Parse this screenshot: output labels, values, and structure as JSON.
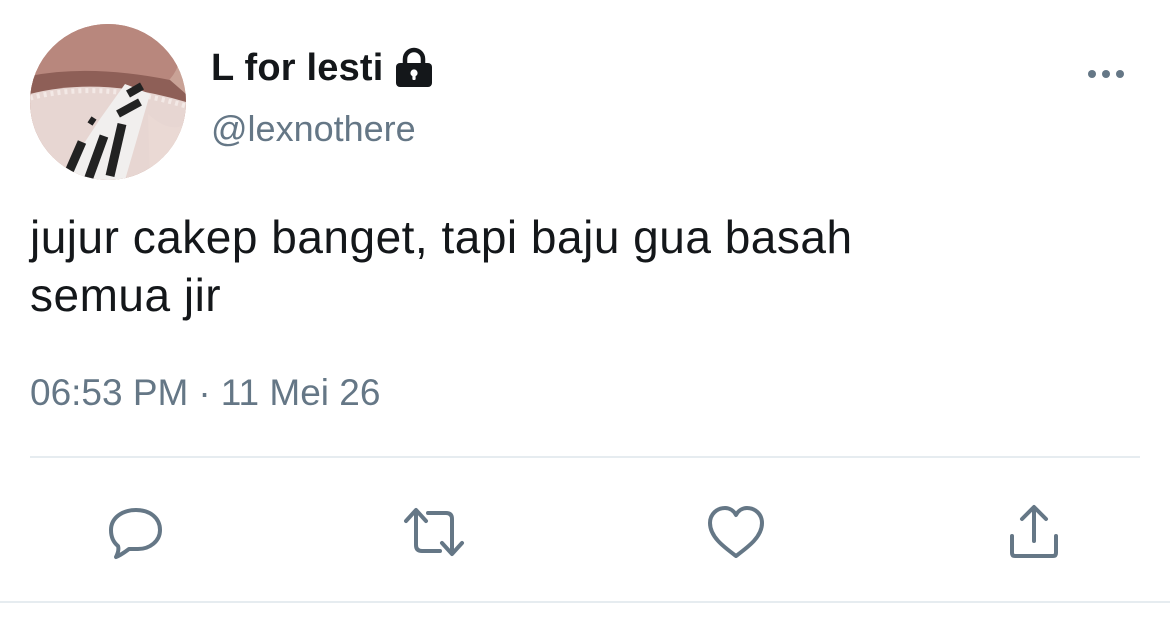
{
  "tweet": {
    "display_name": "L for lesti",
    "handle": "@lexnothere",
    "text_line1": "jujur cakep banget, tapi baju gua basah",
    "text_line2": "semua jir",
    "time": "06:53 PM",
    "separator": "·",
    "date": "11 Mei 26"
  },
  "icons": {
    "protected": "lock-icon",
    "more": "more-horizontal-icon",
    "reply": "reply-icon",
    "retweet": "retweet-icon",
    "like": "heart-icon",
    "share": "share-icon"
  },
  "colors": {
    "text": "#14171a",
    "secondary": "#657786",
    "action_icon": "#657786",
    "divider": "#e6ecf0"
  }
}
